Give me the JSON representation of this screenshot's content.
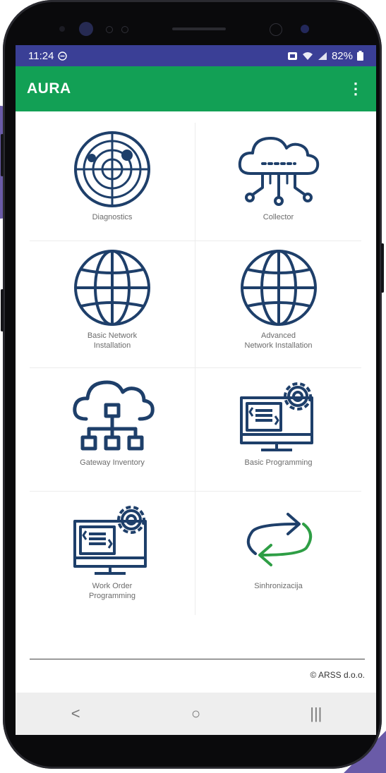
{
  "status_bar": {
    "time": "11:24",
    "battery": "82%"
  },
  "app_bar": {
    "title": "AURA",
    "menu_icon": "more-vert-icon"
  },
  "tiles": [
    {
      "label": "Diagnostics",
      "icon": "radar-icon"
    },
    {
      "label": "Collector",
      "icon": "cloud-network-icon"
    },
    {
      "label": "Basic Network\nInstallation",
      "icon": "globe-icon"
    },
    {
      "label": "Advanced\nNetwork Installation",
      "icon": "globe-icon"
    },
    {
      "label": "Gateway Inventory",
      "icon": "cloud-hierarchy-icon"
    },
    {
      "label": "Basic Programming",
      "icon": "monitor-code-gear-icon"
    },
    {
      "label": "Work Order\nProgramming",
      "icon": "monitor-code-gear-icon"
    },
    {
      "label": "Sinhronizacija",
      "icon": "sync-arrows-icon"
    }
  ],
  "footer": {
    "copyright": "© ARSS d.o.o."
  },
  "nav_bar": {
    "back": "<",
    "home": "○",
    "recents": "|||"
  },
  "colors": {
    "status_bar": "#3a3f96",
    "app_bar": "#12a055",
    "icon_stroke": "#1e3f6a",
    "sync_green": "#2e9e45"
  }
}
